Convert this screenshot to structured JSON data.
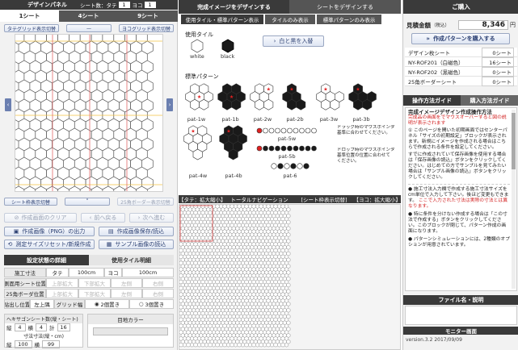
{
  "left": {
    "title": "デザインパネル",
    "sheet_label": "シート数：",
    "tate_label": "タテ",
    "tate_value": "1",
    "yoko_label": "ヨコ",
    "yoko_value": "1",
    "sheet_tabs": [
      "1シート",
      "4シート",
      "9シート"
    ],
    "grid_top_left": "タテグリッド表示切替",
    "grid_top_mid": "—",
    "grid_top_right": "ヨコグリッド表示切替",
    "sheet_toggle": "シート枠表示切替",
    "toggle_mid": "˅",
    "border_toggle": "25角ボーダー表示切替",
    "clear_btn": "作成画面のクリア",
    "undo_btn": "前へ戻る",
    "redo_btn": "次へ進む",
    "png_btn": "作成画像（PNG）の出力",
    "load_btn": "作成画像保存/読込",
    "reset_btn": "測定サイズリセット/新規作成",
    "sample_btn": "サンプル画像の読込",
    "settings_tabs": [
      "設定状態の詳細",
      "使用タイル明細"
    ],
    "settings": {
      "construct_label": "施工寸法",
      "tate": "タテ",
      "tate_val": "100cm",
      "yoko": "ヨコ",
      "yoko_val": "100cm",
      "side_pos": "側面用シート位置",
      "side_vals": [
        "上部拡大",
        "下部拡大",
        "左側",
        "右側"
      ],
      "border_pos": "25角ボーダ位置",
      "border_vals": [
        "上部拡大",
        "下部拡大",
        "左側",
        "右側"
      ],
      "align_label": "貼出し位置",
      "align_val": "左上隅",
      "grid_label": "グリッド幅",
      "grid_opt1": "2個置き",
      "grid_opt2": "3個置き"
    },
    "sheet_size_title": "ヘキサゴンシート数(縦・シート)",
    "tate_short": "縦",
    "tate_cnt": "4",
    "yoko_short": "横",
    "yoko_cnt": "4",
    "total_label": "計",
    "total_cnt": "16",
    "size_title": "寸法寸法(縦・cm)",
    "size_tate": "縦",
    "size_tate_val": "100",
    "size_yoko": "横",
    "size_yoko_val": "99",
    "eye_color_label": "目地カラー"
  },
  "mid": {
    "tabs": [
      "完成イメージをデザインする",
      "シートをデザインする"
    ],
    "subtabs": [
      "使用タイル・標準パターン表示",
      "タイルのみ表示",
      "標準パターンのみ表示"
    ],
    "tile_section": "使用タイル",
    "tile_white": "white",
    "tile_black": "black",
    "swap_btn": "白と黒を入替",
    "pattern_section": "標準パターン",
    "patterns": [
      "pat-1w",
      "pat-1b",
      "pat-2w",
      "pat-2b",
      "pat-3w",
      "pat-3b",
      "pat-4w",
      "pat-4b",
      "pat-5w",
      "pat-5b",
      "pat-6"
    ],
    "drag_note_1": "ドラッグ時のマウスポインタ\n基準に合わせてください。",
    "drag_note_2": "ドロップ時のマウスポインタ\n基準位置の位置に合わせて\nください。",
    "nav_left": "【タテ：拡大縮小】",
    "nav_center": "トータルナビゲーション",
    "nav_sheet": "[シート枠表示切替]",
    "nav_right": "【ヨコ：拡大縮小】"
  },
  "right": {
    "title": "ご購入",
    "price_label": "見積金額",
    "price_tax": "（税込）",
    "price_value": "8,346",
    "price_unit": "円",
    "buy_btn": "作成パターンを購入する",
    "rows": [
      {
        "label": "デザイン枚シート",
        "value": "0シート"
      },
      {
        "label": "NY-ROF201（白磁色）",
        "value": "16シート"
      },
      {
        "label": "NY-ROF202（黒磁色）",
        "value": "0シート"
      },
      {
        "label": "25角ボーダーシート",
        "value": "0シート"
      }
    ],
    "guide_tabs": [
      "操作方法ガイド",
      "購入方法ガイド"
    ],
    "guide_title": "完成イメージデザイン作成操作方法",
    "guide_red": "完成品の画面をでマウスオーバーすると図の説明が表示されます",
    "guide_p1": "① このページを開いた初期画面ではセンターパネル「サイズの初期設定」ブロックが表示されます。新規にイメージを作成される場合はこちらで作成される条件を設定してください。",
    "guide_p2": "すでに作成されていて保存画像を使用する場合は「保存画像の読込」ボタンをクリックしてください。はじめての方でサンプルを見てみたい場合は「サンプル画像の読込」ボタンをクリックしてください。",
    "guide_b1": "施工寸法入力欄で作成する施工寸法サイズをcm単位で入力して下さい。後ほど変更もできます。",
    "guide_b1_red": "ここで入力された寸法は実際の寸法とは異なります。",
    "guide_b2": "特に条件を分けない作成する場合は「この寸法で作成する」ボタンをクリックしてください。このブロックが閉じて、パターン作成の画面になります。",
    "guide_b3": "パターンシミュレーションには、2種類のオプションが用意されています。",
    "file_title": "ファイル名・説明",
    "monitor_title": "モニター画面",
    "version": "version.3.2 2017/09/09"
  }
}
